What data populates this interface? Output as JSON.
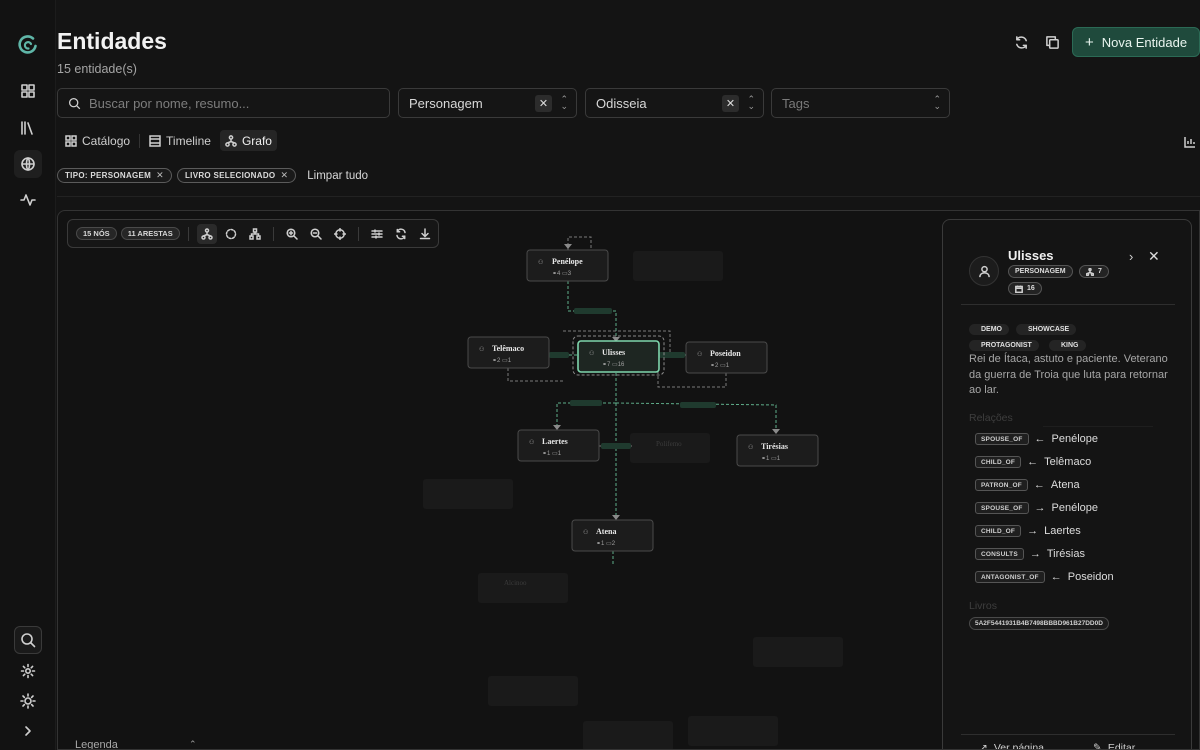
{
  "header": {
    "title": "Entidades",
    "count_text": "15 entidade(s)",
    "new_button_label": "Nova Entidade"
  },
  "filters": {
    "search_placeholder": "Buscar por nome, resumo...",
    "type_value": "Personagem",
    "book_value": "Odisseia",
    "tags_placeholder": "Tags"
  },
  "view_tabs": [
    {
      "label": "Catálogo",
      "icon": "grid-icon"
    },
    {
      "label": "Timeline",
      "icon": "list-icon"
    },
    {
      "label": "Grafo",
      "icon": "graph-icon",
      "active": true
    }
  ],
  "active_filters": {
    "chips": [
      "TIPO: PERSONAGEM",
      "LIVRO SELECIONADO"
    ],
    "clear_all_label": "Limpar tudo"
  },
  "graph": {
    "nodes_badge": "15 NÓS",
    "edges_badge": "11 ARESTAS",
    "legend_label": "Legenda",
    "nodes": [
      {
        "name": "Penélope",
        "relations": "4",
        "books": "3"
      },
      {
        "name": "Telêmaco",
        "relations": "2",
        "books": "1"
      },
      {
        "name": "Ulisses",
        "relations": "7",
        "books": "16"
      },
      {
        "name": "Poseidon",
        "relations": "2",
        "books": "1"
      },
      {
        "name": "Laertes",
        "relations": "1",
        "books": "1"
      },
      {
        "name": "Tirésias",
        "relations": "1",
        "books": "1"
      },
      {
        "name": "Atena",
        "relations": "1",
        "books": "2"
      }
    ],
    "ghost_labels": [
      "Polifemo",
      "Alcinoo"
    ]
  },
  "detail": {
    "name": "Ulisses",
    "type_badge": "PERSONAGEM",
    "relations_count": "7",
    "books_count": "16",
    "tags": [
      "DEMO",
      "SHOWCASE",
      "PROTAGONIST",
      "KING"
    ],
    "description": "Rei de Ítaca, astuto e paciente. Veterano da guerra de Troia que luta para retornar ao lar.",
    "relations_title": "Relações",
    "relations": [
      {
        "type": "SPOUSE_OF",
        "arrow": "←",
        "target": "Penélope"
      },
      {
        "type": "CHILD_OF",
        "arrow": "←",
        "target": "Telêmaco"
      },
      {
        "type": "PATRON_OF",
        "arrow": "←",
        "target": "Atena"
      },
      {
        "type": "SPOUSE_OF",
        "arrow": "→",
        "target": "Penélope"
      },
      {
        "type": "CHILD_OF",
        "arrow": "→",
        "target": "Laertes"
      },
      {
        "type": "CONSULTS",
        "arrow": "→",
        "target": "Tirésias"
      },
      {
        "type": "ANTAGONIST_OF",
        "arrow": "←",
        "target": "Poseidon"
      }
    ],
    "books_title": "Livros",
    "book_id": "5A2F5441931B4B7498BBBD961B27DD0D",
    "view_page_label": "Ver página",
    "edit_label": "Editar"
  },
  "colors": {
    "accent": "#1f4a3c",
    "highlight_edge": "#5fae8a",
    "selected_node": "#7fd6ad"
  }
}
